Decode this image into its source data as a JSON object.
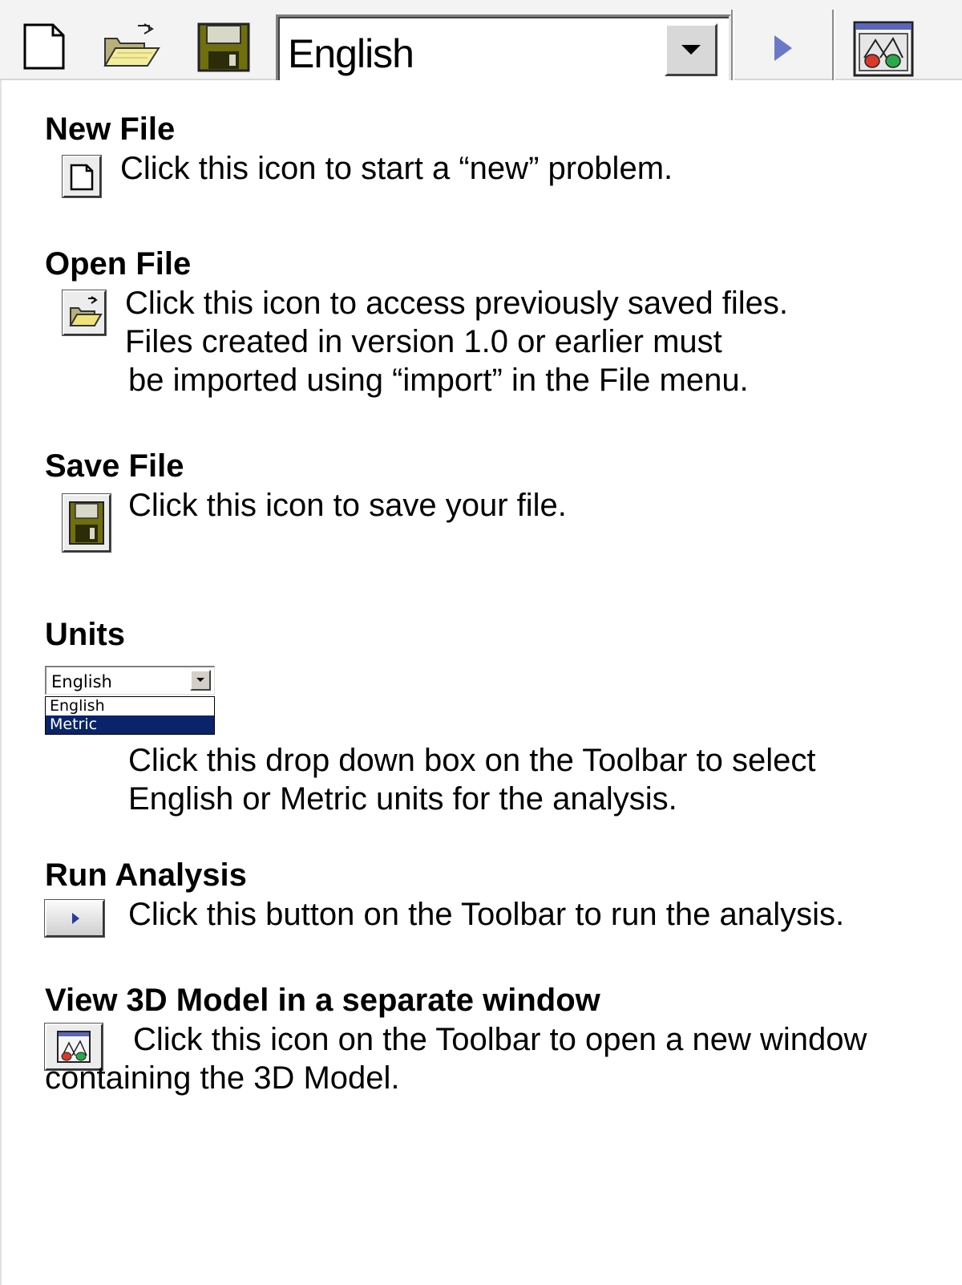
{
  "toolbar": {
    "units_value": "English",
    "items": [
      "new-file",
      "open-file",
      "save-file",
      "units-select",
      "run-analysis",
      "view-3d-model"
    ]
  },
  "sections": {
    "new_file": {
      "heading": "New File",
      "lines": [
        "Click this icon to start a “new” problem."
      ]
    },
    "open_file": {
      "heading": "Open File",
      "lines": [
        "Click this icon to access previously saved files.",
        "Files created in version 1.0 or earlier must",
        "be imported using “import” in the File menu."
      ]
    },
    "save_file": {
      "heading": "Save File",
      "lines": [
        "Click this icon to save your file."
      ]
    },
    "units": {
      "heading": "Units",
      "select_value": "English",
      "options": [
        "English",
        "Metric"
      ],
      "highlighted_option": "Metric",
      "lines": [
        "Click this drop down box on the Toolbar to select",
        "English or Metric units for the analysis."
      ]
    },
    "run_analysis": {
      "heading": "Run Analysis",
      "lines": [
        "Click this button on the Toolbar to run the analysis."
      ]
    },
    "view_3d": {
      "heading": "View 3D Model in a separate window",
      "lines": [
        "Click this icon on the Toolbar to open a new window",
        "containing the 3D Model."
      ]
    }
  },
  "colors": {
    "toolbar_bg": "#f3f3f3",
    "highlight_bg": "#0a246a",
    "run_arrow": "#6a78c8",
    "save_icon": "#7a7a10"
  }
}
